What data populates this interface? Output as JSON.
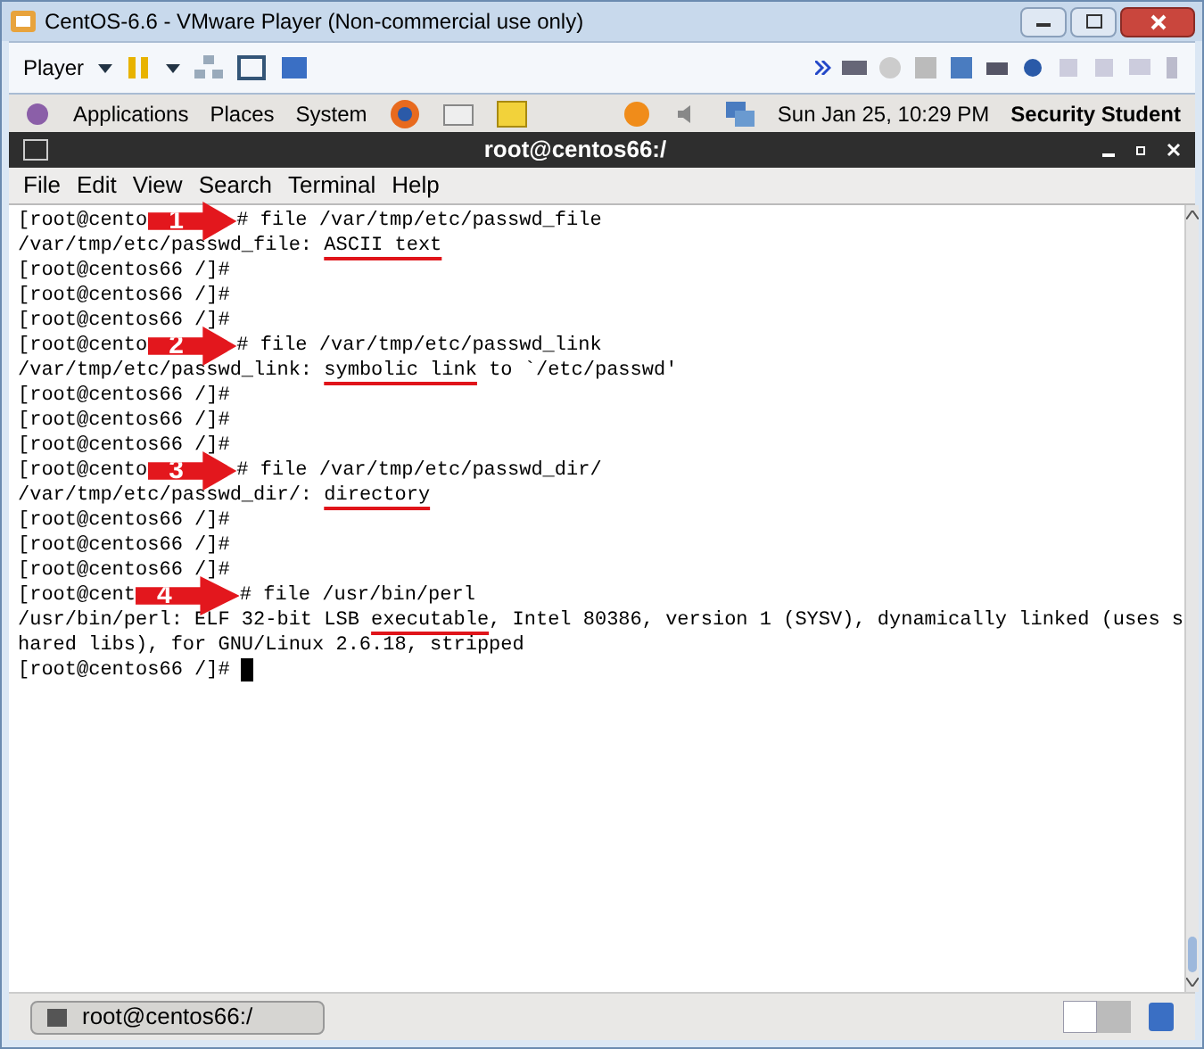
{
  "window": {
    "title": "CentOS-6.6 - VMware Player (Non-commercial use only)"
  },
  "player_toolbar": {
    "menu": "Player"
  },
  "panel": {
    "menus": [
      "Applications",
      "Places",
      "System"
    ],
    "clock": "Sun Jan 25, 10:29 PM",
    "user": "Security Student"
  },
  "terminal": {
    "title": "root@centos66:/",
    "menu": [
      "File",
      "Edit",
      "View",
      "Search",
      "Terminal",
      "Help"
    ],
    "lines": [
      {
        "kind": "annotated",
        "before": "[root@cento",
        "badge": "1",
        "after": "# file /var/tmp/etc/passwd_file"
      },
      {
        "kind": "text",
        "segments": [
          {
            "text": "/var/tmp/etc/passwd_file: ",
            "underlined": false
          },
          {
            "text": "ASCII text",
            "underlined": true
          }
        ]
      },
      {
        "kind": "text",
        "segments": [
          {
            "text": "[root@centos66 /]#",
            "underlined": false
          }
        ]
      },
      {
        "kind": "text",
        "segments": [
          {
            "text": "[root@centos66 /]#",
            "underlined": false
          }
        ]
      },
      {
        "kind": "text",
        "segments": [
          {
            "text": "[root@centos66 /]#",
            "underlined": false
          }
        ]
      },
      {
        "kind": "annotated",
        "before": "[root@cento",
        "badge": "2",
        "after": "# file /var/tmp/etc/passwd_link"
      },
      {
        "kind": "text",
        "segments": [
          {
            "text": "/var/tmp/etc/passwd_link: ",
            "underlined": false
          },
          {
            "text": "symbolic link",
            "underlined": true
          },
          {
            "text": " to `/etc/passwd'",
            "underlined": false
          }
        ]
      },
      {
        "kind": "text",
        "segments": [
          {
            "text": "[root@centos66 /]#",
            "underlined": false
          }
        ]
      },
      {
        "kind": "text",
        "segments": [
          {
            "text": "[root@centos66 /]#",
            "underlined": false
          }
        ]
      },
      {
        "kind": "text",
        "segments": [
          {
            "text": "[root@centos66 /]#",
            "underlined": false
          }
        ]
      },
      {
        "kind": "annotated",
        "before": "[root@cento",
        "badge": "3",
        "after": "# file /var/tmp/etc/passwd_dir/"
      },
      {
        "kind": "text",
        "segments": [
          {
            "text": "/var/tmp/etc/passwd_dir/: ",
            "underlined": false
          },
          {
            "text": "directory",
            "underlined": true
          }
        ]
      },
      {
        "kind": "text",
        "segments": [
          {
            "text": "[root@centos66 /]#",
            "underlined": false
          }
        ]
      },
      {
        "kind": "text",
        "segments": [
          {
            "text": "[root@centos66 /]#",
            "underlined": false
          }
        ]
      },
      {
        "kind": "text",
        "segments": [
          {
            "text": "[root@centos66 /]#",
            "underlined": false
          }
        ]
      },
      {
        "kind": "annotated",
        "before": "[root@cent",
        "badge": "4",
        "after": "# file /usr/bin/perl"
      },
      {
        "kind": "text",
        "segments": [
          {
            "text": "/usr/bin/perl: ELF 32-bit LSB ",
            "underlined": false
          },
          {
            "text": "executable",
            "underlined": true
          },
          {
            "text": ", Intel 80386, version 1 (SYSV), dynamically linked (uses s",
            "underlined": false
          }
        ]
      },
      {
        "kind": "text",
        "segments": [
          {
            "text": "hared libs), for GNU/Linux 2.6.18, stripped",
            "underlined": false
          }
        ]
      },
      {
        "kind": "prompt",
        "segments": [
          {
            "text": "[root@centos66 /]# ",
            "underlined": false
          }
        ]
      }
    ]
  },
  "taskbar": {
    "task": "root@centos66:/"
  }
}
